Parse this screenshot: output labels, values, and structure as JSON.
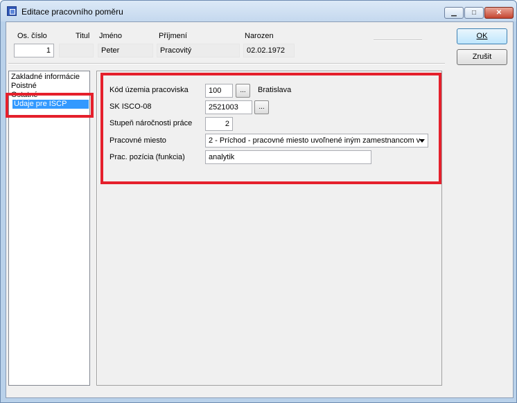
{
  "window": {
    "title": "Editace pracovního poměru"
  },
  "header_fields": {
    "os_cislo": {
      "label": "Os. číslo",
      "value": "1"
    },
    "titul": {
      "label": "Titul",
      "value": ""
    },
    "jmeno": {
      "label": "Jméno",
      "value": "Peter"
    },
    "prijmeni": {
      "label": "Příjmení",
      "value": "Pracovitý"
    },
    "narozen": {
      "label": "Narozen",
      "value": "02.02.1972"
    }
  },
  "buttons": {
    "ok": "OK",
    "cancel": "Zrušit",
    "ellipsis": "..."
  },
  "sidebar": {
    "items": [
      {
        "label": "Zakladné informácie"
      },
      {
        "label": "Poistné"
      },
      {
        "label": "Ostatné"
      },
      {
        "label": "Údaje pre ISCP",
        "selected": true
      }
    ]
  },
  "form": {
    "kod_uzemia": {
      "label": "Kód územia pracoviska",
      "value": "100",
      "lookup_text": "Bratislava"
    },
    "sk_isco": {
      "label": "SK ISCO-08",
      "value": "2521003"
    },
    "stupen": {
      "label": "Stupeň náročnosti práce",
      "value": "2"
    },
    "pracovne_miesto": {
      "label": "Pracovné miesto",
      "value": "2 - Príchod - pracovné miesto uvoľnené iným zamestnancom v"
    },
    "prac_pozicia": {
      "label": "Prac. pozícia (funkcia)",
      "value": "analytik"
    }
  },
  "colors": {
    "highlight": "#e5202c",
    "selection": "#3399ff"
  }
}
